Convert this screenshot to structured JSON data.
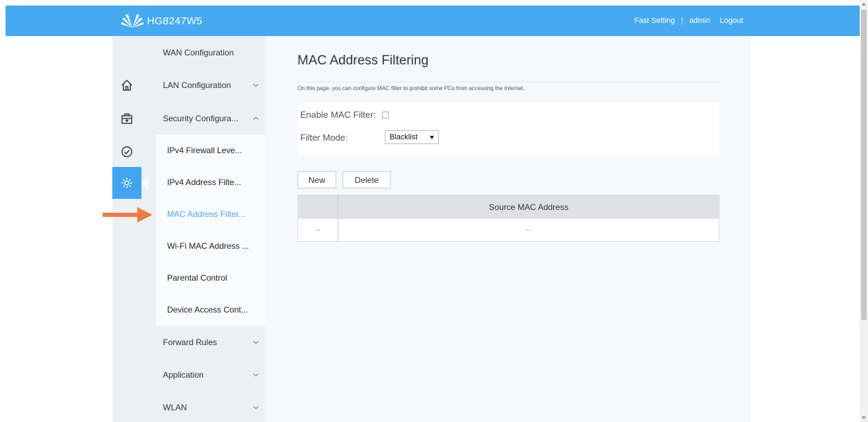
{
  "header": {
    "model": "HG8247W5",
    "links": [
      "Fast Setting",
      "admin",
      "Logout"
    ],
    "separator": "|"
  },
  "iconbar": [
    {
      "icon": "home-icon"
    },
    {
      "icon": "briefcase-icon"
    },
    {
      "icon": "check-circle-icon"
    },
    {
      "icon": "gear-icon",
      "active": true
    }
  ],
  "menu": {
    "wan": "WAN Configuration",
    "lan": "LAN Configuration",
    "security": "Security Configura...",
    "security_sub": [
      "IPv4 Firewall Leve...",
      "IPv4 Address Filte...",
      "MAC Address Filter...",
      "Wi-Fi MAC Address ...",
      "Parental Control",
      "Device Access Cont..."
    ],
    "forward": "Forward Rules",
    "application": "Application",
    "wlan": "WLAN"
  },
  "content": {
    "title": "MAC Address Filtering",
    "description": "On this page, you can configure MAC filter to prohibit some PCs from accessing the Internet.",
    "enable_label": "Enable MAC Filter:",
    "enable_checked": false,
    "mode_label": "Filter Mode:",
    "mode_value": "Blacklist",
    "new_label": "New",
    "delete_label": "Delete",
    "table": {
      "header": "Source MAC Address",
      "row": [
        "--",
        "--"
      ]
    }
  },
  "colors": {
    "topbar": "#45aaf0",
    "active_link": "#49a6ec",
    "arrow": "#f07a43"
  }
}
